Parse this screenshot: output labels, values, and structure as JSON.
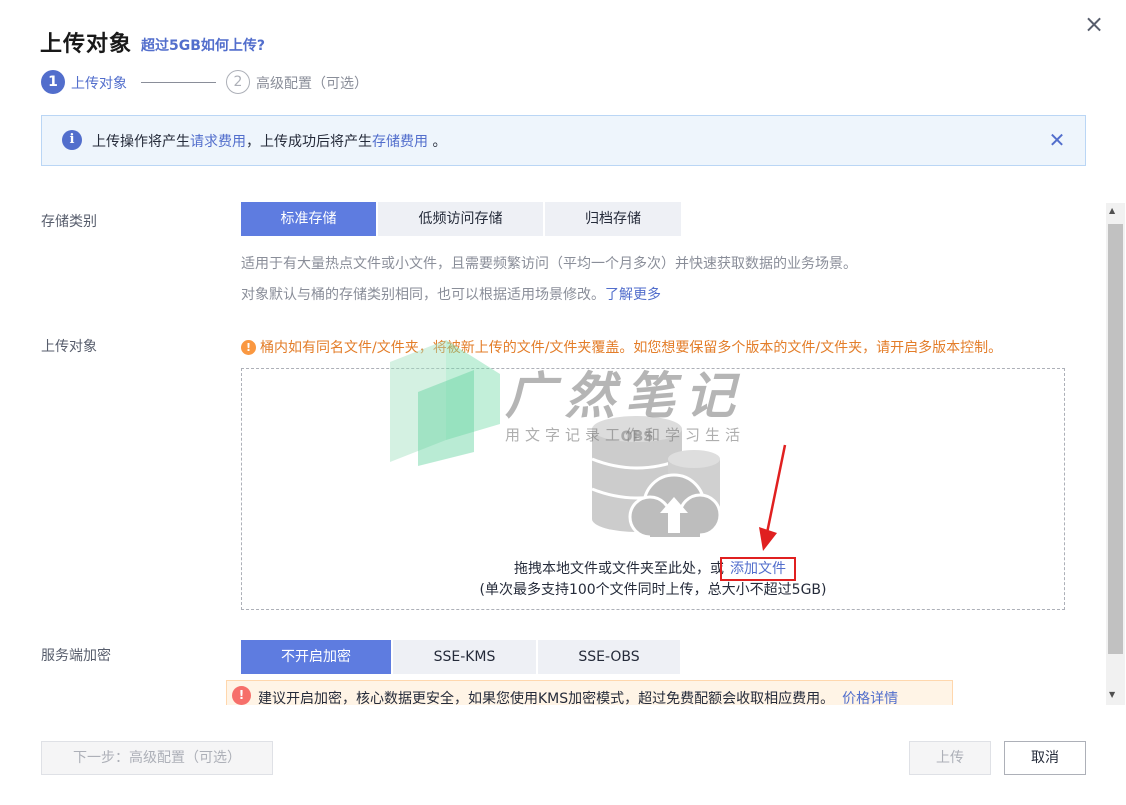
{
  "dialog": {
    "title": "上传对象",
    "title_link": "超过5GB如何上传?",
    "close_icon": "×"
  },
  "steps": [
    {
      "number": "1",
      "label": "上传对象",
      "active": true
    },
    {
      "number": "2",
      "label": "高级配置（可选）",
      "active": false
    }
  ],
  "banner": {
    "icon": "i",
    "text_part1": "上传操作将产生",
    "link1": "请求费用",
    "text_part2": "，上传成功后将产生",
    "link2": "存储费用",
    "text_part3": " 。",
    "close_icon": "✕"
  },
  "storage_class": {
    "label": "存储类别",
    "options": [
      "标准存储",
      "低频访问存储",
      "归档存储"
    ],
    "selected": "标准存储",
    "desc_line1": "适用于有大量热点文件或小文件，且需要频繁访问（平均一个月多次）并快速获取数据的业务场景。",
    "desc_line2": "对象默认与桶的存储类别相同，也可以根据适用场景修改。",
    "learn_more": "了解更多"
  },
  "upload_object": {
    "label": "上传对象",
    "warn_icon": "!",
    "warning": "桶内如有同名文件/文件夹，将被新上传的文件/文件夹覆盖。如您想要保留多个版本的文件/文件夹，请开启多版本控制。",
    "illustration_label": "OBS",
    "drop_text": "拖拽本地文件或文件夹至此处，或",
    "add_file": "添加文件",
    "limit_text": "(单次最多支持100个文件同时上传，总大小不超过5GB)"
  },
  "watermark": {
    "title": "广然笔记",
    "subtitle": "用文字记录工作和学习生活"
  },
  "encryption": {
    "label": "服务端加密",
    "options": [
      "不开启加密",
      "SSE-KMS",
      "SSE-OBS"
    ],
    "selected": "不开启加密",
    "notice_icon": "!",
    "notice": "建议开启加密，核心数据更安全，如果您使用KMS加密模式，超过免费配额会收取相应费用。",
    "pricing_link": "价格详情"
  },
  "scrollbar": {
    "up_icon": "▲",
    "down_icon": "▼"
  },
  "footer": {
    "next_button": "下一步：高级配置（可选）",
    "upload_button": "上传",
    "cancel_button": "取消"
  },
  "colors": {
    "primary": "#526ecc",
    "active_segment": "#5e7ce0",
    "warning_text": "#e37d29",
    "annotation_red": "#e02020"
  }
}
